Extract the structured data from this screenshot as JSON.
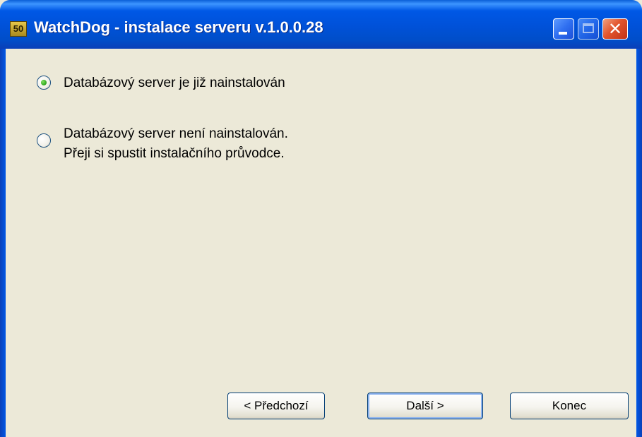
{
  "window": {
    "title": "WatchDog - instalace serveru v.1.0.0.28",
    "app_icon_text": "50",
    "controls": {
      "minimize_icon": "minimize-icon",
      "maximize_icon": "maximize-icon",
      "close_icon": "close-icon",
      "close_glyph": "✕"
    }
  },
  "options": [
    {
      "label_lines": [
        "Databázový server je již nainstalován"
      ],
      "selected": true
    },
    {
      "label_lines": [
        "Databázový server není nainstalován.",
        "Přeji si spustit instalačního průvodce."
      ],
      "selected": false
    }
  ],
  "buttons": {
    "previous": "< Předchozí",
    "next": "Další >",
    "finish": "Konec"
  },
  "colors": {
    "titlebar": "#0058e6",
    "dialog_bg": "#ece9d8",
    "close_button": "#e2542c",
    "radio_selected": "#29a31a"
  }
}
